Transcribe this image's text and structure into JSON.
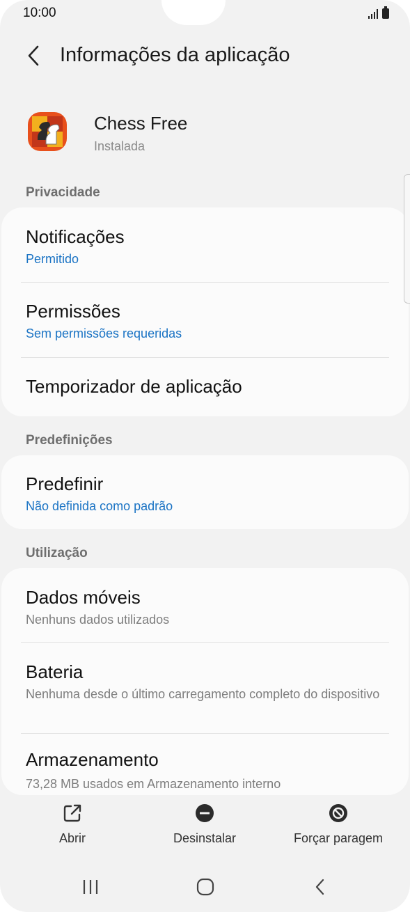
{
  "status_bar": {
    "time": "10:00"
  },
  "header": {
    "title": "Informações da aplicação"
  },
  "app": {
    "name": "Chess Free",
    "status": "Instalada",
    "icon": "chess-knight-icon"
  },
  "sections": {
    "privacy": {
      "header": "Privacidade",
      "items": [
        {
          "title": "Notificações",
          "subtitle": "Permitido"
        },
        {
          "title": "Permissões",
          "subtitle": "Sem permissões requeridas"
        },
        {
          "title": "Temporizador de aplicação"
        }
      ]
    },
    "defaults": {
      "header": "Predefinições",
      "items": [
        {
          "title": "Predefinir",
          "subtitle": "Não definida como padrão"
        }
      ]
    },
    "usage": {
      "header": "Utilização",
      "items": [
        {
          "title": "Dados móveis",
          "subtitle": "Nenhuns dados utilizados"
        },
        {
          "title": "Bateria",
          "subtitle": "Nenhuma desde o último carregamento completo do dispositivo"
        },
        {
          "title": "Armazenamento",
          "subtitle": "73,28 MB usados em Armazenamento interno"
        }
      ]
    }
  },
  "actions": {
    "open": {
      "label": "Abrir",
      "icon": "open-external-icon"
    },
    "uninstall": {
      "label": "Desinstalar",
      "icon": "uninstall-icon"
    },
    "force_stop": {
      "label": "Forçar paragem",
      "icon": "force-stop-icon"
    }
  },
  "colors": {
    "accent": "#1a73c4",
    "background": "#f2f2f2",
    "card": "#fbfbfb"
  }
}
